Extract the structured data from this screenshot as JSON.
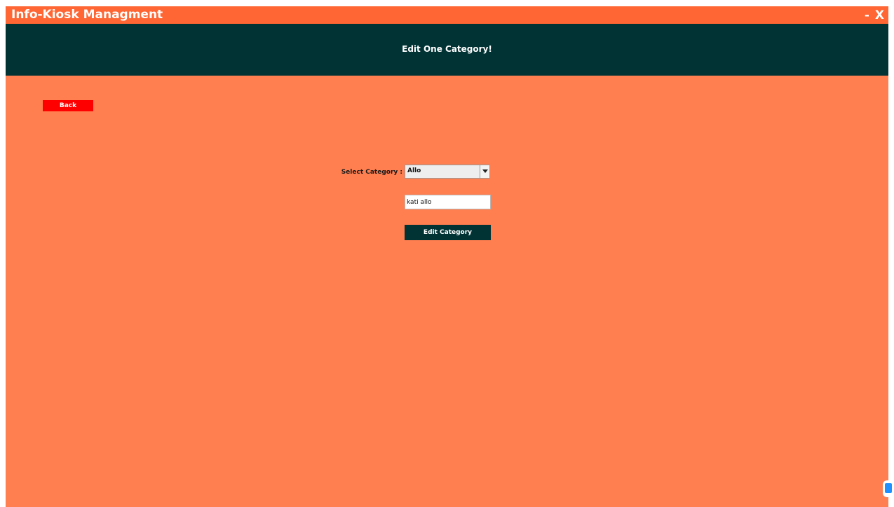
{
  "window": {
    "title": "Info-Kiosk Managment",
    "minimize_label": "-",
    "close_label": "X"
  },
  "header": {
    "title": "Edit One Category!"
  },
  "back_button": {
    "label": "Back"
  },
  "form": {
    "select_label": "Select Category :",
    "select_value": "Allo",
    "name_value": "kati allo",
    "submit_label": "Edit Category"
  },
  "colors": {
    "titlebar": "#ff6633",
    "background": "#ff7f50",
    "header_band": "#013335",
    "back_button": "#ff0000",
    "primary_button": "#013335"
  },
  "icons": {
    "select_arrow": "chevron-down-icon",
    "corner_badge": "app-badge-icon"
  }
}
